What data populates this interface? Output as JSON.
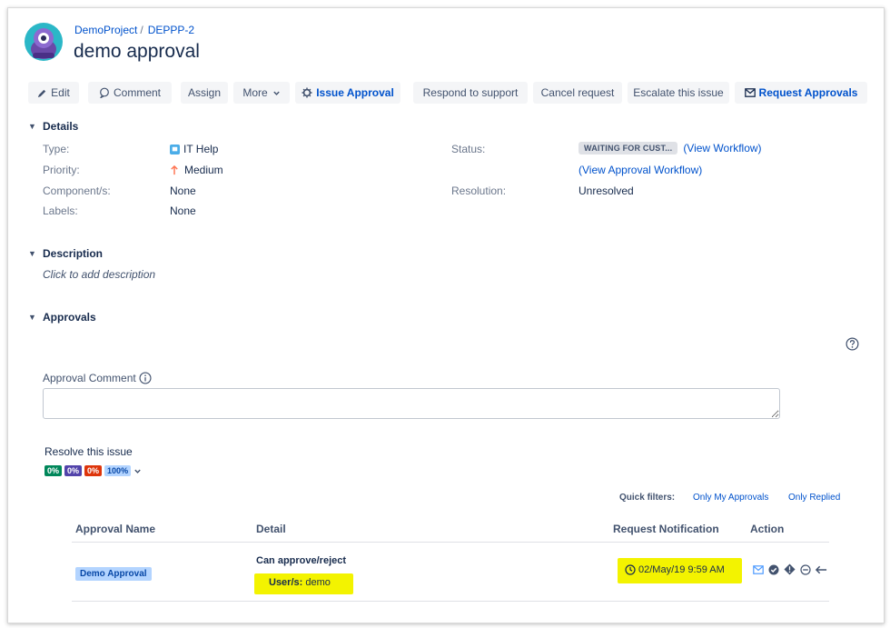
{
  "breadcrumb": {
    "project": "DemoProject",
    "separator": "/",
    "issue_key": "DEPPP-2"
  },
  "page_title": "demo approval",
  "toolbar": {
    "edit": "Edit",
    "comment": "Comment",
    "assign": "Assign",
    "more": "More",
    "issue_approval": "Issue Approval",
    "respond": "Respond to support",
    "cancel": "Cancel request",
    "escalate": "Escalate this issue",
    "request_approvals": "Request Approvals"
  },
  "details": {
    "heading": "Details",
    "type_label": "Type:",
    "type_value": "IT Help",
    "priority_label": "Priority:",
    "priority_value": "Medium",
    "component_label": "Component/s:",
    "component_value": "None",
    "labels_label": "Labels:",
    "labels_value": "None",
    "status_label": "Status:",
    "status_value": "WAITING FOR CUST...",
    "view_workflow": "(View Workflow)",
    "view_approval_workflow": "(View Approval Workflow)",
    "resolution_label": "Resolution:",
    "resolution_value": "Unresolved"
  },
  "description": {
    "heading": "Description",
    "placeholder": "Click to add description"
  },
  "approvals": {
    "heading": "Approvals",
    "comment_label": "Approval Comment",
    "resolve_label": "Resolve this issue",
    "progress": [
      {
        "label": "0%",
        "color": "#00875a"
      },
      {
        "label": "0%",
        "color": "#5243aa"
      },
      {
        "label": "0%",
        "color": "#de350b"
      },
      {
        "label": "100%",
        "color": "#b3d4ff"
      }
    ],
    "quick_filters_label": "Quick filters:",
    "filter_my": "Only My Approvals",
    "filter_replied": "Only Replied",
    "columns": {
      "name": "Approval Name",
      "detail": "Detail",
      "notification": "Request Notification",
      "action": "Action"
    },
    "row": {
      "name": "Demo Approval",
      "detail_title": "Can approve/reject",
      "users_label": "User/s:",
      "users_value": "demo",
      "notification_time": "02/May/19 9:59 AM"
    }
  },
  "colors": {
    "link": "#0052cc",
    "highlight": "#f3f300",
    "text": "#172b4d"
  },
  "icons": [
    "project-avatar-icon",
    "pencil-icon",
    "comment-icon",
    "chevron-down-icon",
    "gear-icon",
    "envelope-icon",
    "help-icon",
    "info-icon",
    "clock-icon",
    "check-circle-icon",
    "warning-diamond-icon",
    "minus-circle-icon",
    "reply-arrow-icon",
    "it-help-type-icon",
    "priority-arrow-up-icon"
  ]
}
